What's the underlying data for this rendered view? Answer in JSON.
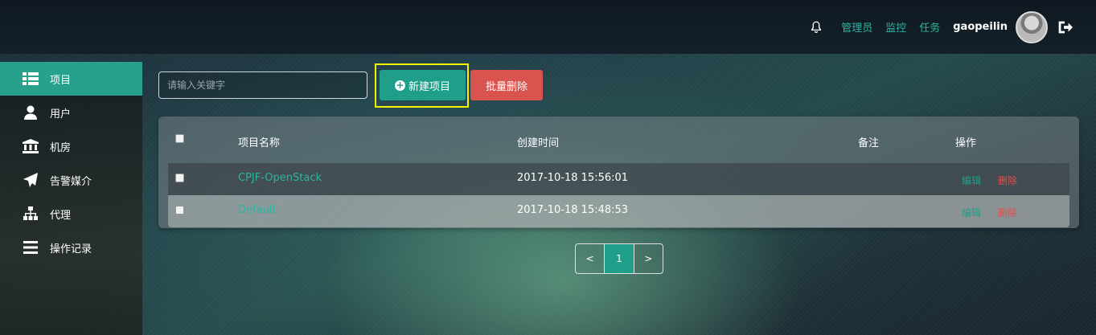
{
  "header": {
    "nav": [
      {
        "label": "管理员"
      },
      {
        "label": "监控"
      },
      {
        "label": "任务"
      }
    ],
    "username": "gaopeilin",
    "accent": "#2cb5a0"
  },
  "sidebar": {
    "items": [
      {
        "label": "项目",
        "icon": "list-icon",
        "active": true
      },
      {
        "label": "用户",
        "icon": "user-icon"
      },
      {
        "label": "机房",
        "icon": "bank-icon"
      },
      {
        "label": "告警媒介",
        "icon": "paper-plane-icon"
      },
      {
        "label": "代理",
        "icon": "sitemap-icon"
      },
      {
        "label": "操作记录",
        "icon": "bars-icon"
      }
    ]
  },
  "toolbar": {
    "search_placeholder": "请输入关键字",
    "new_label": "新建项目",
    "batch_delete_label": "批量删除"
  },
  "table": {
    "columns": [
      "项目名称",
      "创建时间",
      "备注",
      "操作"
    ],
    "rows": [
      {
        "name": "CPJF-OpenStack",
        "created": "2017-10-18 15:56:01",
        "note": "",
        "edit": "编辑",
        "delete": "删除"
      },
      {
        "name": "Default",
        "created": "2017-10-18 15:48:53",
        "note": "",
        "edit": "编辑",
        "delete": "删除"
      }
    ]
  },
  "pagination": {
    "prev": "<",
    "current": "1",
    "next": ">"
  },
  "colors": {
    "primary": "#1f9e8a",
    "danger": "#d9534f",
    "highlight": "#f5f500"
  }
}
